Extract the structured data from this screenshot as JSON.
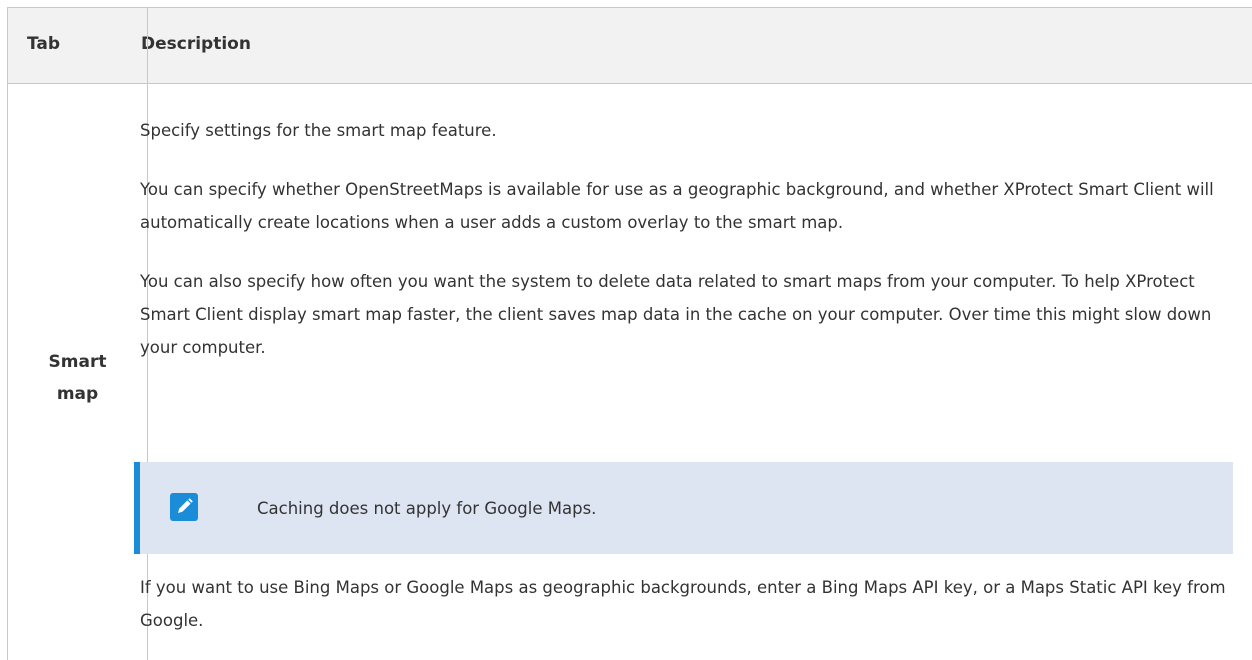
{
  "table": {
    "headers": {
      "tab": "Tab",
      "description": "Description"
    },
    "row": {
      "tab_name": "Smart map",
      "paragraphs": [
        "Specify settings for the smart map feature.",
        "You can specify whether OpenStreetMaps is available for use as a geographic background, and whether XProtect Smart Client will automatically create locations when a user adds a custom overlay to the smart map.",
        "You can also specify how often you want the system to delete data related to smart maps from your computer. To help XProtect Smart Client display smart map faster, the client saves map data in the cache on your computer. Over time this might slow down your computer.",
        "If you want to use Bing Maps or Google Maps as geographic backgrounds, enter a Bing Maps API key, or a Maps Static API key from Google."
      ],
      "note": {
        "icon": "pencil-edit-icon",
        "text": "Caching does not apply for Google Maps."
      }
    }
  },
  "colors": {
    "header_background": "#f2f2f2",
    "border": "#c8c8c8",
    "note_background": "#dde5f3",
    "note_accent": "#1a8cd8",
    "text": "#333333"
  }
}
